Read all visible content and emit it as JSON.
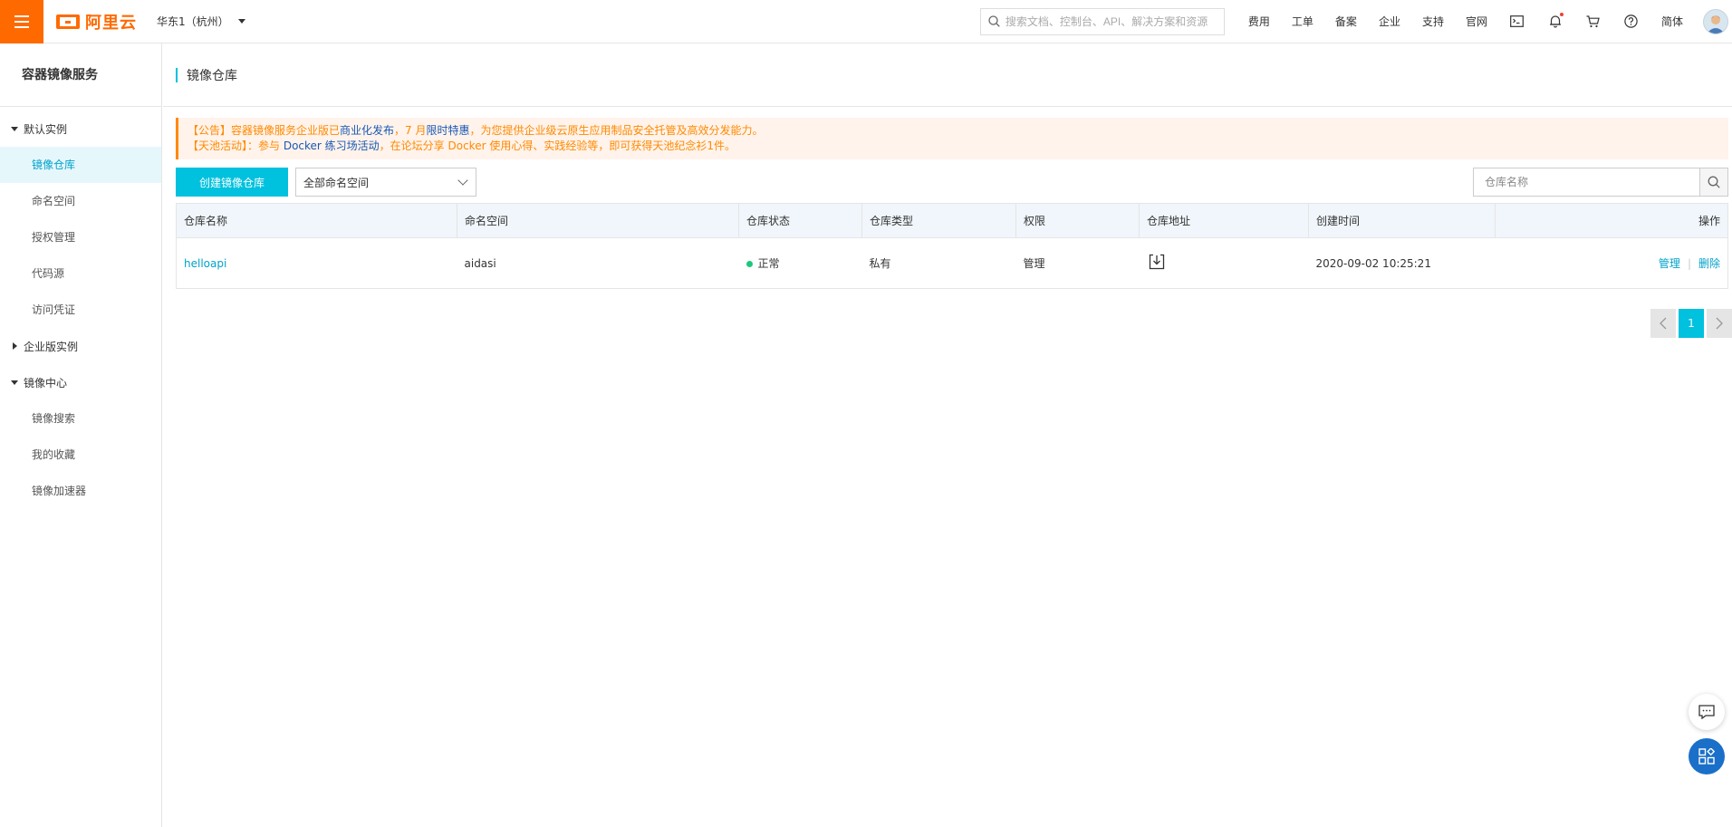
{
  "topbar": {
    "logo_text": "阿里云",
    "region": "华东1（杭州）",
    "search_placeholder": "搜索文档、控制台、API、解决方案和资源",
    "links": [
      "费用",
      "工单",
      "备案",
      "企业",
      "支持",
      "官网"
    ],
    "lang": "简体"
  },
  "sidebar": {
    "title": "容器镜像服务",
    "group_default": "默认实例",
    "items_default": [
      "镜像仓库",
      "命名空间",
      "授权管理",
      "代码源",
      "访问凭证"
    ],
    "group_enterprise": "企业版实例",
    "group_center": "镜像中心",
    "items_center": [
      "镜像搜索",
      "我的收藏",
      "镜像加速器"
    ]
  },
  "page": {
    "title": "镜像仓库"
  },
  "notice": {
    "l1_a": "【公告】容器镜像服务企业版已",
    "l1_hl1": "商业化发布",
    "l1_b": "，7 月",
    "l1_hl2": "限时特惠",
    "l1_c": "，为您提供企业级云原生应用制品安全托管及高效分发能力。",
    "l2_a": "【天池活动】：参与",
    "l2_hl1": " Docker 练习场活动",
    "l2_b": "，在论坛分享 Docker 使用心得、实践经验等，即可获得天池纪念衫1件。"
  },
  "toolbar": {
    "create_label": "创建镜像仓库",
    "namespace_select": "全部命名空间",
    "search_placeholder": "仓库名称"
  },
  "table": {
    "headers": [
      "仓库名称",
      "命名空间",
      "仓库状态",
      "仓库类型",
      "权限",
      "仓库地址",
      "创建时间",
      "操作"
    ],
    "rows": [
      {
        "name": "helloapi",
        "namespace": "aidasi",
        "status": "正常",
        "type": "私有",
        "permission": "管理",
        "created": "2020-09-02 10:25:21",
        "action_manage": "管理",
        "action_sep": "|",
        "action_delete": "删除"
      }
    ]
  },
  "pagination": {
    "current": "1"
  },
  "colors": {
    "brand": "#ff6a00",
    "primary": "#00c1de",
    "link": "#00a2ca",
    "status_ok": "#1ec87b"
  }
}
